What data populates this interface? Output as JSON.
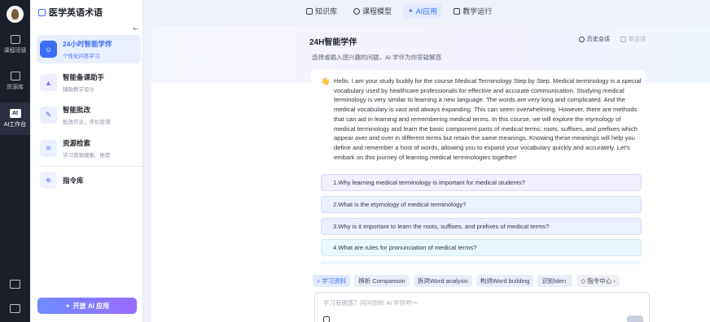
{
  "app": {
    "name": "医学英语术语"
  },
  "rail": {
    "items": [
      {
        "label": "课程班级",
        "icon": "class-icon"
      },
      {
        "label": "资源库",
        "icon": "library-icon"
      },
      {
        "label": "AI工作台",
        "icon": "ai-icon",
        "badge": "AI"
      }
    ]
  },
  "sidebar": {
    "items": [
      {
        "title": "24小时智能学伴",
        "desc": "个性化问答学习",
        "icon": "chat-bot-icon",
        "color": "#3b6ef6"
      },
      {
        "title": "智能备课助手",
        "desc": "辅助教学设计",
        "icon": "lesson-plan-icon",
        "color": "#9b6bff"
      },
      {
        "title": "智能批改",
        "desc": "批改作业，评价反馈",
        "icon": "grading-icon",
        "color": "#3b6ef6"
      },
      {
        "title": "资源检索",
        "desc": "学习资源搜索、推荐",
        "icon": "search-resource-icon",
        "color": "#4f8cff"
      },
      {
        "title": "指令库",
        "desc": "",
        "icon": "prompt-library-icon",
        "color": "#8fb0ff"
      }
    ],
    "open_button": "开放 AI 应用"
  },
  "tabs": [
    {
      "label": "知识库",
      "icon": "knowledge-icon"
    },
    {
      "label": "课程模型",
      "icon": "model-icon"
    },
    {
      "label": "AI应用",
      "icon": "ai-app-icon"
    },
    {
      "label": "教学运行",
      "icon": "teaching-icon"
    }
  ],
  "main": {
    "title": "24H智能学伴",
    "subtitle": "选择或输入感兴趣的问题，AI 学伴为你答疑解惑",
    "history": "历史会话",
    "new_chat": "新会话"
  },
  "message": {
    "emoji": "👋",
    "text": "Hello, I am your study buddy for the course Medical Terminology Step by Step. Medical terminology is a special vocabulary used by healthcare professionals for effective and accurate communication. Studying medical terminology is very similar to learning a new language. The words are very long and complicated. And the medical vocabulary is vast and always expanding. This can seem overwhelming. However, there are methods that can aid in learning and remembering medical terms. In this course, we will explore the etymology of medical terminology and learn the basic component parts of medical terms: roots, suffixes, and prefixes which appear over and over in different terms but retain the same meanings. Knowing these meanings will help you define and remember a host of words, allowing you to expand your vocabulary quickly and accurately. Let's embark on this journey of learning medical terminologies together!"
  },
  "questions": [
    {
      "text": "1.Why learning medical terminology is important for medical students?",
      "bg": "#f2efff",
      "border": "#ddd6fb"
    },
    {
      "text": "2.What is the etymology of medical terminology?",
      "bg": "#ecf1ff",
      "border": "#d3dcf8"
    },
    {
      "text": "3.Why is it important to learn the roots, suffixes, and prefixes of medical terms?",
      "bg": "#ecf1ff",
      "border": "#d3dcf8"
    },
    {
      "text": "4.What are rules for pronunciation of medical terms?",
      "bg": "#eaf7ff",
      "border": "#cfe9fb"
    }
  ],
  "chips": [
    "学习资料",
    "辨析 Comparison",
    "拆词Word analysis",
    "构词Word building",
    "识别Iden",
    "指令中心"
  ],
  "input": {
    "placeholder": "学习有困惑？问问你的 AI 学伴吧～"
  }
}
